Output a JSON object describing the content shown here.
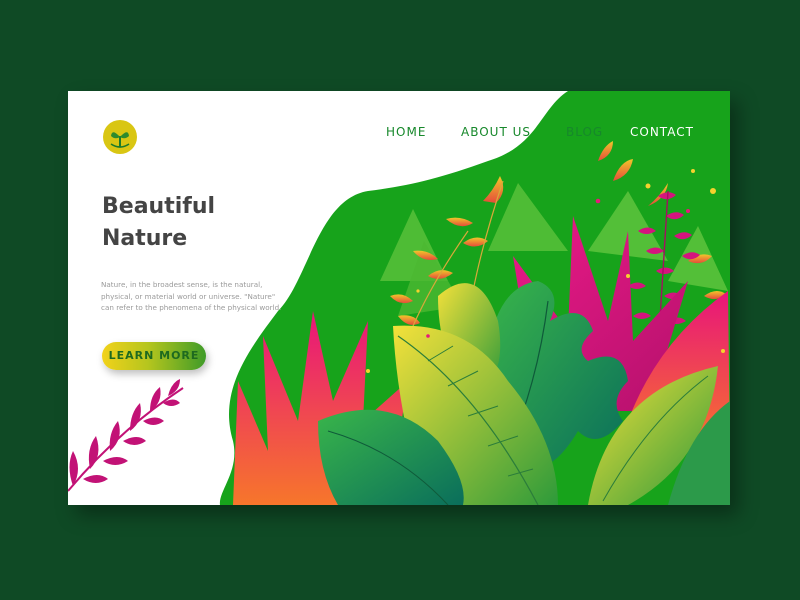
{
  "nav": {
    "items": [
      {
        "label": "HOME"
      },
      {
        "label": "ABOUT US"
      },
      {
        "label": "BLOG"
      },
      {
        "label": "CONTACT"
      }
    ]
  },
  "hero": {
    "title_line1": "Beautiful",
    "title_line2": "Nature",
    "description": "Nature, in the broadest sense, is the natural, physical, or material world or universe. \"Nature\" can refer to the phenomena of the physical world.",
    "cta_label": "LEARN MORE"
  },
  "logo": {
    "icon": "sprout-icon"
  },
  "colors": {
    "background": "#0f4a25",
    "accent_green": "#17a31b",
    "nav_text": "#17882b",
    "title": "#444444",
    "button_start": "#f2d21a",
    "button_end": "#3f9b28",
    "pink": "#e6197a"
  }
}
